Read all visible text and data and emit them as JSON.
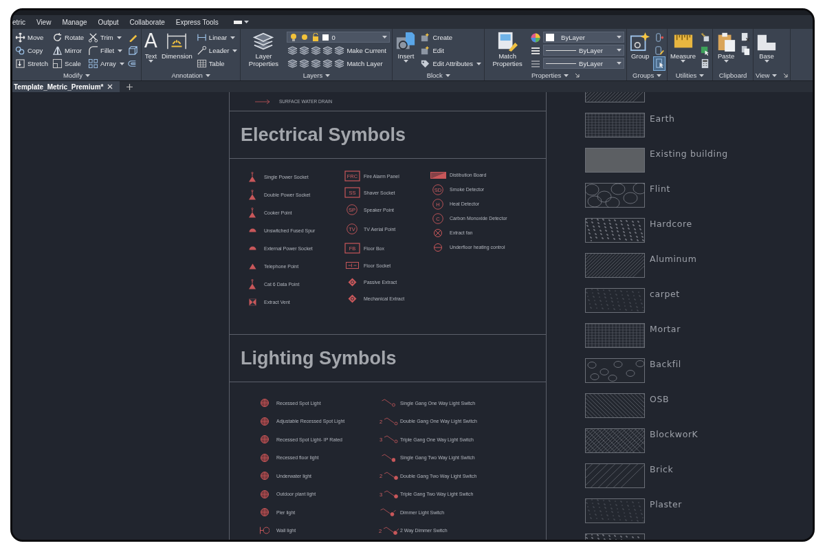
{
  "menu": {
    "items": [
      "etric",
      "View",
      "Manage",
      "Output",
      "Collaborate",
      "Express Tools"
    ]
  },
  "ribbon": {
    "panels": [
      {
        "title": "Modify",
        "dropdown": true,
        "columns": [
          [
            {
              "kind": "small",
              "label": "Move"
            },
            {
              "kind": "small",
              "label": "Copy"
            },
            {
              "kind": "small",
              "label": "Stretch"
            }
          ],
          [
            {
              "kind": "small",
              "label": "Rotate"
            },
            {
              "kind": "small",
              "label": "Mirror"
            },
            {
              "kind": "small",
              "label": "Scale"
            }
          ],
          [
            {
              "kind": "small",
              "label": "Trim",
              "dropdown": true
            },
            {
              "kind": "small",
              "label": "Fillet",
              "dropdown": true
            },
            {
              "kind": "small",
              "label": "Array",
              "dropdown": true
            }
          ],
          [
            {
              "kind": "icon"
            },
            {
              "kind": "icon"
            },
            {
              "kind": "icon"
            }
          ]
        ]
      },
      {
        "title": "Annotation",
        "dropdown": true,
        "columns": [
          [
            {
              "kind": "large",
              "glyph": "A",
              "label": "Text",
              "dropdown": true
            }
          ],
          [
            {
              "kind": "large",
              "label": "Dimension"
            }
          ],
          [
            {
              "kind": "small",
              "label": "Linear",
              "dropdown": true
            },
            {
              "kind": "small",
              "label": "Leader",
              "dropdown": true
            },
            {
              "kind": "small",
              "label": "Table"
            }
          ]
        ]
      },
      {
        "title": "Layers",
        "dropdown": true,
        "columns": [
          [
            {
              "kind": "large",
              "label": "Layer Properties"
            }
          ],
          [
            {
              "kind": "layer_combo",
              "value": "0"
            },
            {
              "kind": "multi",
              "label": "Make Current"
            },
            {
              "kind": "multi",
              "label": "Match Layer"
            }
          ]
        ]
      },
      {
        "title": "Block",
        "dropdown": true,
        "columns": [
          [
            {
              "kind": "large",
              "label": "Insert",
              "dropdown": true
            }
          ],
          [
            {
              "kind": "small",
              "label": "Create"
            },
            {
              "kind": "small",
              "label": "Edit"
            },
            {
              "kind": "small",
              "label": "Edit Attributes",
              "dropdown": true
            }
          ]
        ]
      },
      {
        "title": "Properties",
        "dropdown": true,
        "launcher": true,
        "columns": [
          [
            {
              "kind": "large",
              "label": "Match Properties"
            }
          ],
          [
            {
              "kind": "color_combo",
              "value": "ByLayer"
            },
            {
              "kind": "line_combo",
              "value": "ByLayer"
            },
            {
              "kind": "line_combo",
              "value": "ByLayer"
            }
          ]
        ]
      },
      {
        "title": "Groups",
        "dropdown": true,
        "columns": [
          [
            {
              "kind": "large",
              "label": "Group"
            }
          ],
          [
            {
              "kind": "icon"
            },
            {
              "kind": "icon"
            },
            {
              "kind": "icon",
              "selected": true
            }
          ]
        ]
      },
      {
        "title": "Utilities",
        "dropdown": true,
        "columns": [
          [
            {
              "kind": "large",
              "label": "Measure",
              "dropdown": true
            }
          ],
          [
            {
              "kind": "icon"
            },
            {
              "kind": "icon"
            },
            {
              "kind": "icon"
            }
          ]
        ]
      },
      {
        "title": "Clipboard",
        "columns": [
          [
            {
              "kind": "large",
              "label": "Paste",
              "dropdown": true
            }
          ],
          [
            {
              "kind": "icon"
            },
            {
              "kind": "icon"
            }
          ]
        ]
      },
      {
        "title": "View",
        "dropdown": true,
        "launcher": true,
        "columns": [
          [
            {
              "kind": "large",
              "label": "Base",
              "dropdown": true
            }
          ]
        ]
      }
    ]
  },
  "document_tabs": [
    {
      "label": "Template_Metric_Premium*",
      "selected": true
    }
  ],
  "drawing": {
    "top_item": {
      "label": "SURFACE WATER DRAIN"
    },
    "sections": [
      {
        "title": "Electrical Symbols",
        "columns": [
          [
            {
              "kind": "socket",
              "label": "Single Power Socket"
            },
            {
              "kind": "socket",
              "label": "Double Power Socket"
            },
            {
              "kind": "socket",
              "label": "Cooker Point"
            },
            {
              "kind": "half",
              "label": "Unswitched Fused Spur"
            },
            {
              "kind": "half",
              "label": "External Power Socket"
            },
            {
              "kind": "triangle",
              "label": "Telephone Point"
            },
            {
              "kind": "socket",
              "label": "Cat 6 Data Point"
            },
            {
              "kind": "bowtie",
              "label": "Extract Vent"
            }
          ],
          [
            {
              "kind": "box",
              "tag": "FRC",
              "label": "Fire Alarm Panel"
            },
            {
              "kind": "box",
              "tag": "SS",
              "label": "Shaver Socket"
            },
            {
              "kind": "circle",
              "tag": "SP",
              "label": "Speaker Point"
            },
            {
              "kind": "circle",
              "tag": "TV",
              "label": "TV Aerial Point"
            },
            {
              "kind": "box",
              "tag": "FB",
              "label": "Floor Box"
            },
            {
              "kind": "floor",
              "label": "Floor Socket"
            },
            {
              "kind": "diamond",
              "label": "Passive Extract"
            },
            {
              "kind": "diamond",
              "label": "Mechanical Extract"
            }
          ],
          [
            {
              "kind": "board",
              "label": "Distibution Board"
            },
            {
              "kind": "circle",
              "tag": "SD",
              "label": "Smoke Detector"
            },
            {
              "kind": "circle",
              "tag": "H",
              "label": "Heat Detector"
            },
            {
              "kind": "circle",
              "tag": "C",
              "label": "Carbon Monoxide Detector"
            },
            {
              "kind": "fan",
              "label": "Extract fan"
            },
            {
              "kind": "dial",
              "label": "Underfloor heating control"
            }
          ]
        ]
      },
      {
        "title": "Lighting Symbols",
        "columns": [
          [
            {
              "kind": "lamp",
              "label": "Recessed Spot Light"
            },
            {
              "kind": "lamp",
              "label": "Adjustable Recessed Spot Light"
            },
            {
              "kind": "lamp",
              "label": "Recessed Spot Light- IP Rated"
            },
            {
              "kind": "lamp",
              "label": "Recessed floor light"
            },
            {
              "kind": "lamp",
              "label": "Underwater light"
            },
            {
              "kind": "lamp",
              "label": "Outdoor plant light"
            },
            {
              "kind": "lamp",
              "label": "Pier light"
            },
            {
              "kind": "wall_lamp",
              "label": "Wall light"
            }
          ],
          [
            {
              "kind": "switch_open",
              "label": "Single Gang One Way Light Switch"
            },
            {
              "kind": "switch_open",
              "tag": "2",
              "label": "Double Gang One Way Light Switch"
            },
            {
              "kind": "switch_open",
              "tag": "3",
              "label": "Triple Gang One Way Light Switch"
            },
            {
              "kind": "switch_dot",
              "label": "Single Gang Two Way Light Switch"
            },
            {
              "kind": "switch_dot",
              "tag": "2",
              "label": "Double Gang Two Way Light Switch"
            },
            {
              "kind": "switch_dot",
              "tag": "3",
              "label": "Triple Gang Two Way Light Switch"
            },
            {
              "kind": "dimmer",
              "label": "Dimmer Light Switch"
            },
            {
              "kind": "dimmer",
              "tag": "2",
              "label": "2 Way Dimmer Switch"
            }
          ]
        ]
      }
    ]
  },
  "hatches": [
    {
      "kind": "diagonal"
    },
    {
      "kind": "weave",
      "label": "Earth"
    },
    {
      "kind": "solid",
      "label": "Existing building"
    },
    {
      "kind": "cells",
      "label": "Flint"
    },
    {
      "kind": "dense",
      "label": "Hardcore"
    },
    {
      "kind": "diagonal",
      "label": "Aluminum"
    },
    {
      "kind": "speckle",
      "label": "carpet"
    },
    {
      "kind": "grid",
      "label": "Mortar"
    },
    {
      "kind": "pebbles",
      "label": "Backfil"
    },
    {
      "kind": "backslash",
      "label": "OSB"
    },
    {
      "kind": "cross",
      "label": "BlockworK"
    },
    {
      "kind": "wide",
      "label": "Brick"
    },
    {
      "kind": "speckle",
      "label": "Plaster"
    },
    {
      "kind": "dense"
    }
  ]
}
